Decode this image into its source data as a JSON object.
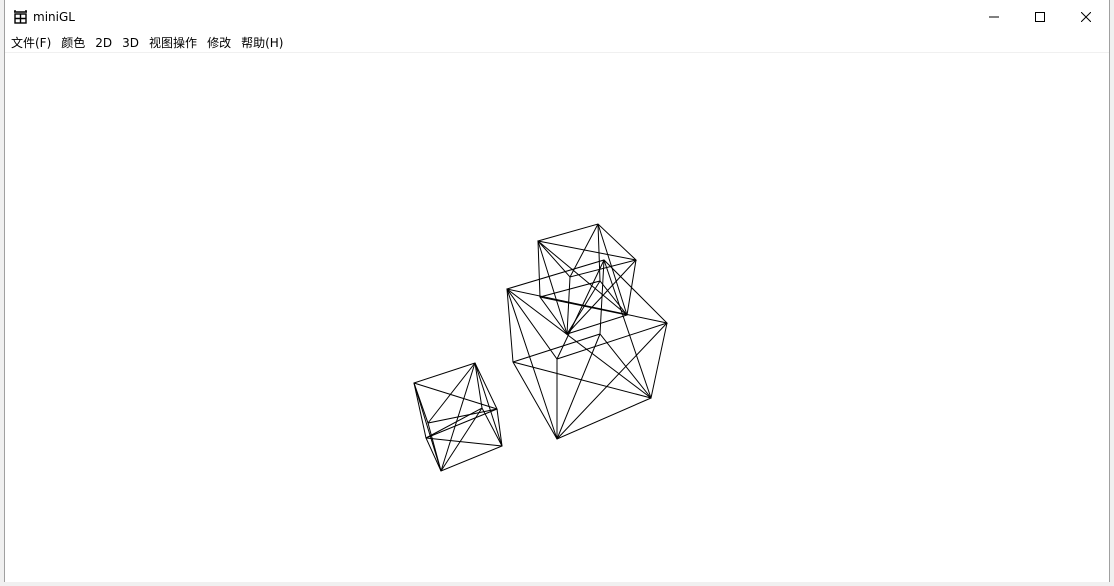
{
  "window": {
    "title": "miniGL",
    "app_icon": "grid-app-icon",
    "controls": {
      "minimize": "minimize-icon",
      "maximize": "maximize-icon",
      "close": "close-icon"
    }
  },
  "menubar": {
    "items": [
      "文件(F)",
      "颜色",
      "2D",
      "3D",
      "视图操作",
      "修改",
      "帮助(H)"
    ]
  },
  "colors": {
    "wireframe": "#000000",
    "background": "#ffffff"
  }
}
